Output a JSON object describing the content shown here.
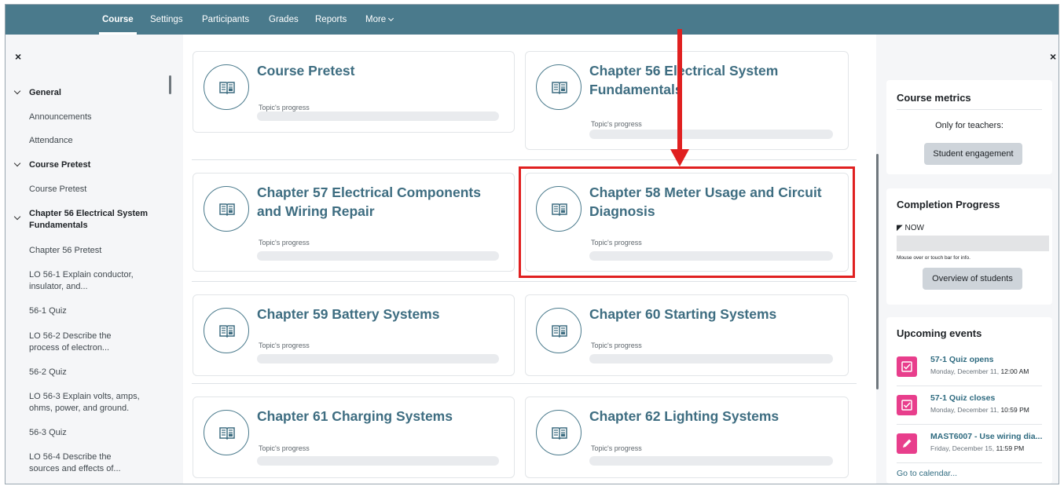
{
  "nav": {
    "items": [
      {
        "label": "Course",
        "active": true
      },
      {
        "label": "Settings"
      },
      {
        "label": "Participants"
      },
      {
        "label": "Grades"
      },
      {
        "label": "Reports"
      },
      {
        "label": "More"
      }
    ]
  },
  "left_drawer": {
    "close_icon": "×",
    "items": [
      {
        "label": "General",
        "type": "section"
      },
      {
        "label": "Announcements",
        "type": "child"
      },
      {
        "label": "Attendance",
        "type": "child"
      },
      {
        "label": "Course Pretest",
        "type": "section"
      },
      {
        "label": "Course Pretest",
        "type": "child"
      },
      {
        "label": "Chapter 56 Electrical System Fundamentals",
        "type": "section"
      },
      {
        "label": "Chapter 56 Pretest",
        "type": "child"
      },
      {
        "label": "LO 56-1 Explain conductor, insulator, and...",
        "type": "child"
      },
      {
        "label": "56-1 Quiz",
        "type": "child"
      },
      {
        "label": "LO 56-2 Describe the process of electron...",
        "type": "child"
      },
      {
        "label": "56-2 Quiz",
        "type": "child"
      },
      {
        "label": "LO 56-3 Explain volts, amps, ohms, power, and ground.",
        "type": "child"
      },
      {
        "label": "56-3 Quiz",
        "type": "child"
      },
      {
        "label": "LO 56-4 Describe the sources and effects of...",
        "type": "child"
      }
    ]
  },
  "topics": [
    {
      "title": "Course Pretest",
      "progress_label": "Topic's progress",
      "progress": 0
    },
    {
      "title": "Chapter 56 Electrical System Fundamentals",
      "progress_label": "Topic's progress",
      "progress": 0
    },
    {
      "title": "Chapter 57 Electrical Components and Wiring Repair",
      "progress_label": "Topic's progress",
      "progress": 0
    },
    {
      "title": "Chapter 58 Meter Usage and Circuit Diagnosis",
      "progress_label": "Topic's progress",
      "progress": 0
    },
    {
      "title": "Chapter 59 Battery Systems",
      "progress_label": "Topic's progress",
      "progress": 0
    },
    {
      "title": "Chapter 60 Starting Systems",
      "progress_label": "Topic's progress",
      "progress": 0
    },
    {
      "title": "Chapter 61 Charging Systems",
      "progress_label": "Topic's progress",
      "progress": 0
    },
    {
      "title": "Chapter 62 Lighting Systems",
      "progress_label": "Topic's progress",
      "progress": 0
    }
  ],
  "right_drawer": {
    "close_icon": "×",
    "course_metrics": {
      "title": "Course metrics",
      "note": "Only for teachers:",
      "button": "Student engagement"
    },
    "completion": {
      "title": "Completion Progress",
      "now_label": "NOW",
      "hint": "Mouse over or touch bar for info.",
      "button": "Overview of students"
    },
    "events": {
      "title": "Upcoming events",
      "items": [
        {
          "title": "57-1 Quiz opens",
          "date": "Monday, December 11, ",
          "time": "12:00 AM",
          "icon": "quiz-icon"
        },
        {
          "title": "57-1 Quiz closes",
          "date": "Monday, December 11, ",
          "time": "10:59 PM",
          "icon": "quiz-icon"
        },
        {
          "title": "MAST6007 - Use wiring dia...",
          "date": "Friday, December 15, ",
          "time": "11:59 PM",
          "icon": "assignment-icon"
        }
      ],
      "calendar_link": "Go to calendar..."
    }
  },
  "colors": {
    "nav_bg": "#4a7a8c",
    "title_color": "#3e6d81",
    "annotation": "#e02020",
    "event_icon": "#e83e8c"
  }
}
